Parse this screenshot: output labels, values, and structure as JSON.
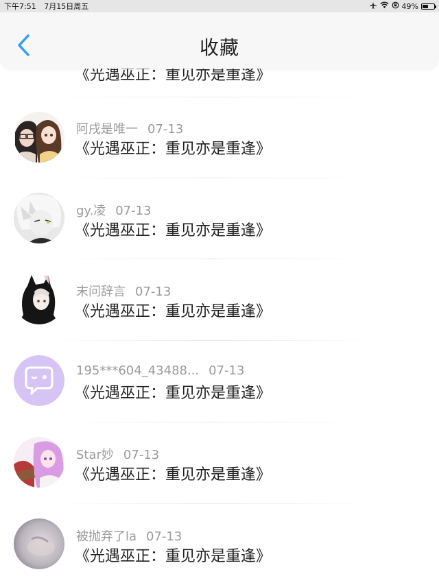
{
  "status_bar": {
    "time": "下午7:51",
    "date": "7月15日周五",
    "battery_text": "49%",
    "battery_level": 0.49,
    "icons": [
      "airplane-icon",
      "wifi-icon",
      "orientation-lock-icon",
      "battery-icon"
    ]
  },
  "header": {
    "title": "收藏",
    "back_icon": "chevron-left-icon",
    "accent_color": "#3a9ff0"
  },
  "partial_item": {
    "title": "《光遇巫正：重见亦是重逢》"
  },
  "items": [
    {
      "author": "阿戌是唯一",
      "date": "07-13",
      "title": "《光遇巫正：重见亦是重逢》",
      "avatar": "anime-couple-avatar"
    },
    {
      "author": "gy.凌",
      "date": "07-13",
      "title": "《光遇巫正：重见亦是重逢》",
      "avatar": "white-hair-boy-avatar"
    },
    {
      "author": "末问辞言",
      "date": "07-13",
      "title": "《光遇巫正：重见亦是重逢》",
      "avatar": "hooded-cat-ear-avatar"
    },
    {
      "author": "195***604_43488...",
      "date": "07-13",
      "title": "《光遇巫正：重见亦是重逢》",
      "avatar": "default-chat-bubble-avatar"
    },
    {
      "author": "Star妙",
      "date": "07-13",
      "title": "《光遇巫正：重见亦是重逢》",
      "avatar": "pink-hair-girl-avatar"
    },
    {
      "author": "被抛弃了la",
      "date": "07-13",
      "title": "《光遇巫正：重见亦是重逢》",
      "avatar": "blurry-photo-avatar"
    }
  ],
  "colors": {
    "default_avatar_bg": "#d6c4f4",
    "meta_text": "#9a9a9a",
    "title_text": "#222222"
  }
}
